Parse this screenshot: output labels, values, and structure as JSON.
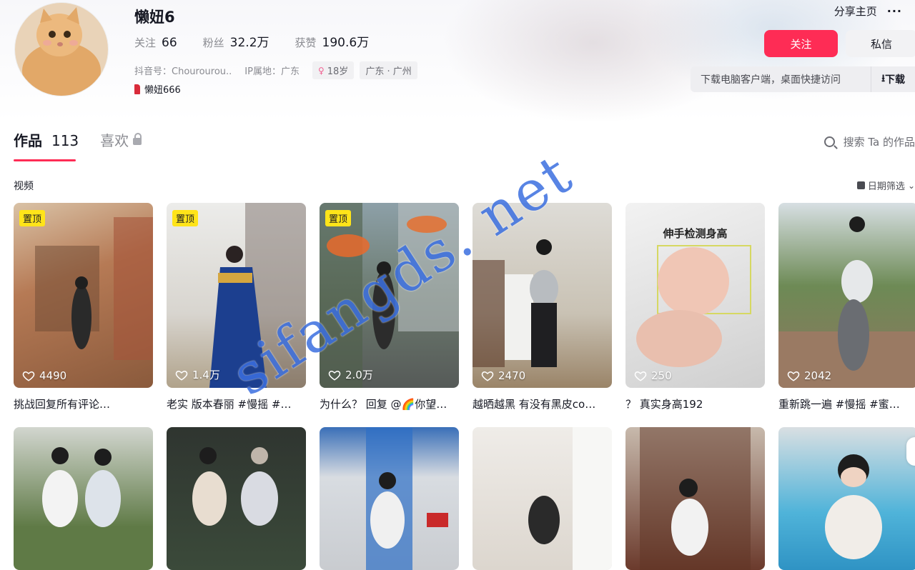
{
  "profile": {
    "nickname": "懒妞6",
    "stats": [
      {
        "label": "关注",
        "value": "66"
      },
      {
        "label": "粉丝",
        "value": "32.2万"
      },
      {
        "label": "获赞",
        "value": "190.6万"
      }
    ],
    "douyin_id": "抖音号：Chourourou..",
    "ip_location": "IP属地：广东",
    "age": "18岁",
    "region": "广东 · 广州",
    "fan_tag": "懒妞666"
  },
  "top_right": {
    "share_label": "分享主页",
    "more_icon": "···"
  },
  "actions": {
    "follow_label": "关注",
    "message_label": "私信",
    "download_text": "下载电脑客户端，桌面快捷访问",
    "download_label": "下载",
    "download_icon": "⭳"
  },
  "tabs": {
    "works_label": "作品",
    "works_count": "113",
    "likes_label": "喜欢"
  },
  "search": {
    "label": "搜索 Ta 的作品"
  },
  "section_label": "视频",
  "date_filter": "日期筛选",
  "videos": [
    {
      "pinned": "置顶",
      "likes": "4490",
      "caption": "挑战回复所有评论…"
    },
    {
      "pinned": "置顶",
      "likes": "1.4万",
      "caption": "老实 版本春丽 #慢摇 #…"
    },
    {
      "pinned": "置顶",
      "likes": "2.0万",
      "caption": "为什么？ 回复 @🌈你望…"
    },
    {
      "pinned": "",
      "likes": "2470",
      "caption": "越晒越黑 有没有黑皮co…"
    },
    {
      "pinned": "",
      "likes": "250",
      "caption": "？ 真实身高192",
      "overlay_text": "伸手检测身高"
    },
    {
      "pinned": "",
      "likes": "2042",
      "caption": "重新跳一遍 #慢摇 #蜜大…"
    }
  ],
  "watermark": "sifangds. net",
  "colors": {
    "accent": "#fe2c55",
    "pin": "#ffe419",
    "watermark": "#3b6fe0"
  }
}
